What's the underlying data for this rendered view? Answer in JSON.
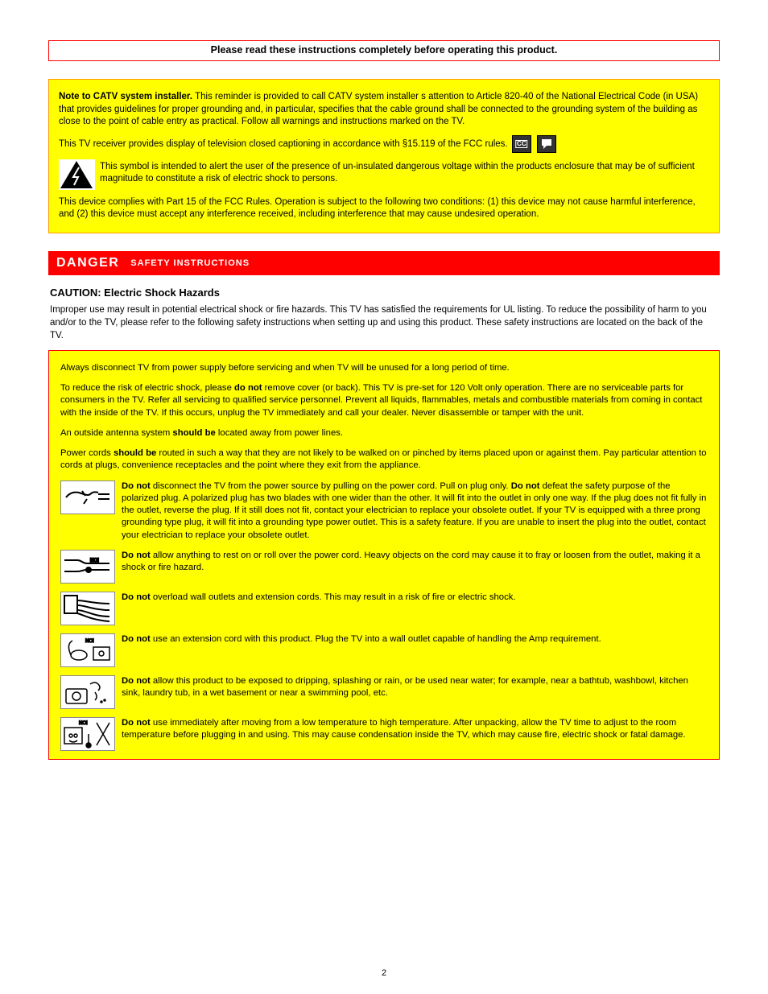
{
  "redbox": "Please read these instructions completely before operating this product.",
  "yb1": {
    "line1a": "Note to CATV system installer. ",
    "line1b": "This reminder is provided to call CATV system installer s attention to Article 820-40 of the National Electrical Code (in USA) that provides guidelines for proper grounding and, in particular, specifies that the cable ground shall be connected to the grounding system of the building as close to the point of cable entry as practical. Follow all warnings and instructions marked on the TV.",
    "line2a": "This TV receiver provides display of television closed captioning in accordance with §15.119 of the FCC rules.",
    "line3a": "This symbol is intended to alert the user of the presence of un-insulated dangerous voltage within the products enclosure that may be of sufficient magnitude to constitute a risk of electric shock to persons.",
    "line4a": "This device complies with Part 15 of the FCC Rules. Operation is subject to the following two conditions: (1) this device may not cause harmful interference, and (2) this device must accept any interference received, including interference that may cause undesired operation."
  },
  "danger": {
    "title": "DANGER",
    "sub": "SAFETY INSTRUCTIONS",
    "heading": "CAUTION: Electric Shock Hazards",
    "para1": "Improper use may result in potential electrical shock or fire hazards. This TV has satisfied the requirements for UL listing. To reduce the possibility of harm to you and/or to the TV, please refer to the following safety instructions when setting up and using this product. These safety instructions are located on the back of the TV."
  },
  "yl": {
    "p1": "Always disconnect TV from power supply before servicing and when TV will be unused for a long period of time.",
    "p2a": "To reduce the risk of electric shock, please ",
    "p2b": "do not",
    "p2c": " remove cover (or back). This TV is pre-set for 120 Volt only operation. There are no serviceable parts for consumers in the TV. Refer all servicing to qualified service personnel. Prevent all liquids, flammables, metals and combustible materials from coming in contact with the inside of the TV. If this occurs, unplug the TV immediately and call your dealer. Never disassemble or tamper with the unit.",
    "p3a": "An outside antenna system ",
    "p3b": "should be",
    "p3c": " located away from power lines.",
    "p4a": "Power cords ",
    "p4b": "should be",
    "p4c": " routed in such a way that they are not likely to be walked on or pinched by items placed upon or against them. Pay particular attention to cords at plugs, convenience receptacles and the point where they exit from the appliance.",
    "row1": {
      "a": "Do not",
      "b": " disconnect the TV from the power source by pulling on the power cord. Pull on plug only.",
      "c": " defeat the safety purpose of the polarized plug. A polarized plug has two blades with one wider than the other. It will fit into the outlet in only one way. If the plug does not fit fully in the outlet, reverse the plug. If it still does not fit, contact your electrician to replace your obsolete outlet. If your TV is equipped with a three prong grounding type plug, it will fit into a grounding type power outlet. This is a safety feature. If you are unable to insert the plug into the outlet, contact your electrician to replace your obsolete outlet."
    },
    "row2": {
      "a": "Do not",
      "b": " allow anything to rest on or roll over the power cord. Heavy objects on the cord may cause it to fray or loosen from the outlet, making it a shock or fire hazard."
    },
    "row3": {
      "a": "Do not",
      "b": " overload wall outlets and extension cords. This may result in a risk of fire or electric shock."
    },
    "row4": {
      "a": "Do not",
      "b": " use an extension cord with this product. Plug the TV into a wall outlet capable of handling the Amp requirement."
    },
    "row5": {
      "a": "Do not",
      "b": " allow this product to be exposed to dripping, splashing or rain, or be used near water; for example, near a bathtub, washbowl, kitchen sink, laundry tub, in a wet basement or near a swimming pool, etc."
    },
    "row6": {
      "a": "Do not",
      "b": " use immediately after moving from a low temperature to high temperature. After unpacking, allow the TV time to adjust to the room temperature before plugging in and using. This may cause condensation inside the TV, which may cause fire, electric shock or fatal damage."
    }
  },
  "pagenum": "2"
}
